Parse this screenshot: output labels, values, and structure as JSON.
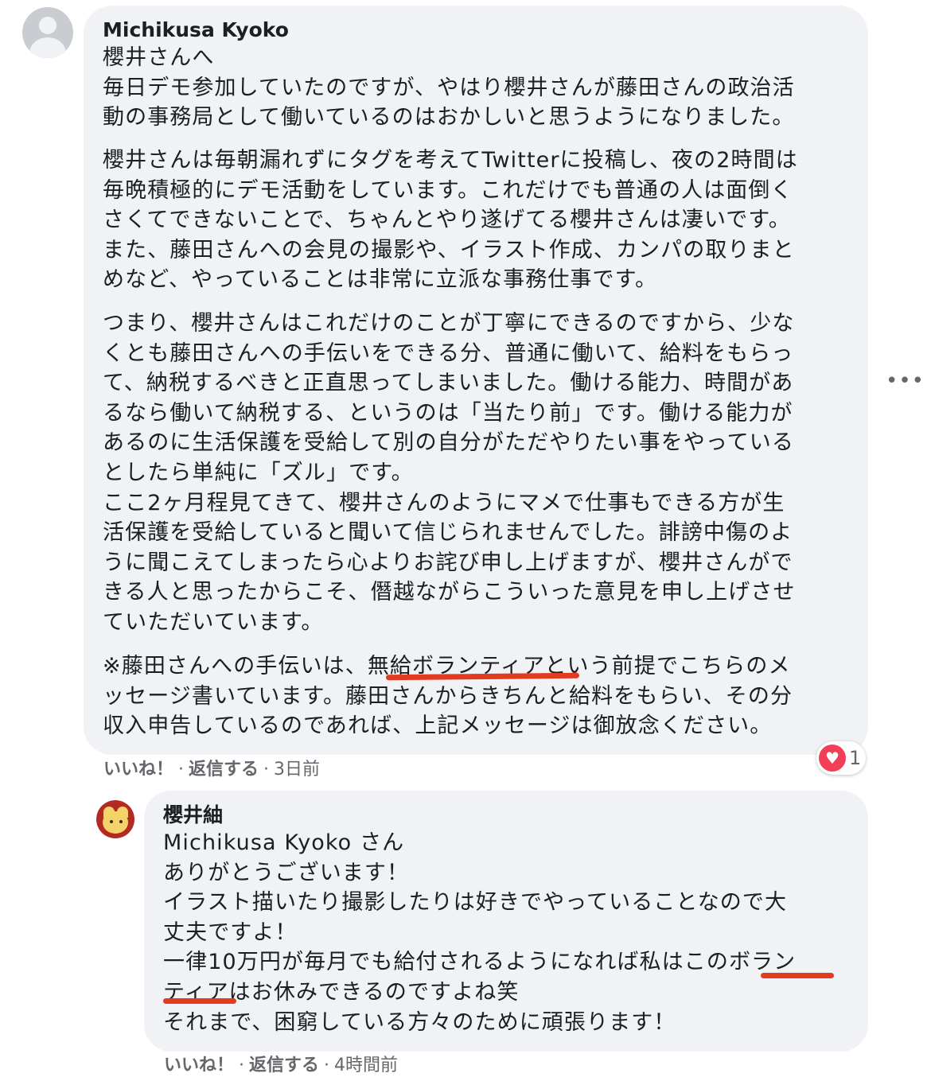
{
  "comment": {
    "author": "Michikusa Kyoko",
    "lines_p1": "櫻井さんへ\n毎日デモ参加していたのですが、やはり櫻井さんが藤田さんの政治活\n動の事務局として働いているのはおかしいと思うようになりました。",
    "lines_p2": "櫻井さんは毎朝漏れずにタグを考えてTwitterに投稿し、夜の2時間は\n毎晩積極的にデモ活動をしています。これだけでも普通の人は面倒く\nさくてできないことで、ちゃんとやり遂げてる櫻井さんは凄いです。\nまた、藤田さんへの会見の撮影や、イラスト作成、カンパの取りまと\nめなど、やっていることは非常に立派な事務仕事です。",
    "lines_p3": "つまり、櫻井さんはこれだけのことが丁寧にできるのですから、少な\nくとも藤田さんへの手伝いをできる分、普通に働いて、給料をもらっ\nて、納税するべきと正直思ってしまいました。働ける能力、時間があ\nるなら働いて納税する、というのは「当たり前」です。働ける能力が\nあるのに生活保護を受給して別の自分がただやりたい事をやっている\nとしたら単純に「ズル」です。\nここ2ヶ月程見てきて、櫻井さんのようにマメで仕事もできる方が生\n活保護を受給していると聞いて信じられませんでした。誹謗中傷のよ\nうに聞こえてしまったら心よりお詫び申し上げますが、櫻井さんがで\nきる人と思ったからこそ、僭越ながらこういった意見を申し上げさせ\nていただいています。",
    "lines_p4": "※藤田さんへの手伝いは、無給ボランティアという前提でこちらのメ\nッセージ書いています。藤田さんからきちんと給料をもらい、その分\n収入申告しているのであれば、上記メッセージは御放念ください。",
    "like": "いいね！",
    "reply": "返信する",
    "time": "3日前",
    "reaction_count": "1",
    "reaction_icon": "heart-icon",
    "separator": "·",
    "more_icon": "•••",
    "heart_glyph": "♥"
  },
  "reply": {
    "author": "櫻井紬",
    "body": "Michikusa Kyoko さん\nありがとうございます！\nイラスト描いたり撮影したりは好きでやっていることなので大\n丈夫ですよ！\n一律10万円が毎月でも給付されるようになれば私はこのボラン\nティアはお休みできるのですよね笑\nそれまで、困窮している方々のために頑張ります！",
    "like": "いいね！",
    "reply": "返信する",
    "time": "4時間前"
  },
  "colors": {
    "bubble": "#f0f2f5",
    "underline": "#e23b22",
    "heart": "#f33e58",
    "meta": "#65676b"
  }
}
